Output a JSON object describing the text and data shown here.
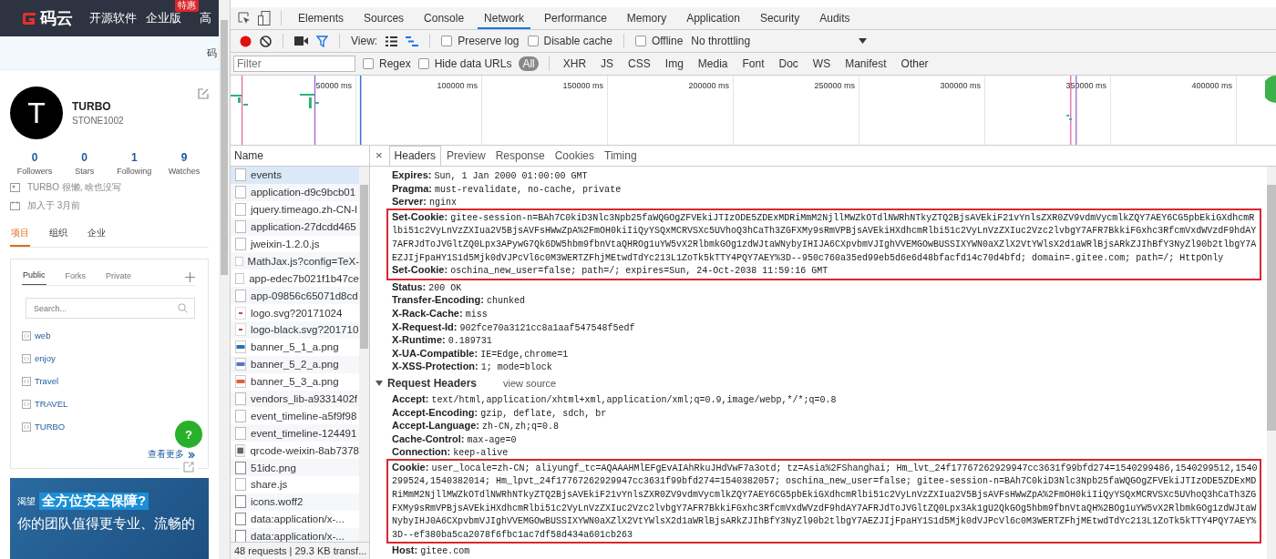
{
  "site": {
    "logo": "码云",
    "nav": [
      {
        "label": "开源软件"
      },
      {
        "label": "企业版",
        "badge": "特惠"
      },
      {
        "label": "高"
      }
    ],
    "subbar": "码",
    "profile": {
      "avatar_letter": "T",
      "name": "TURBO",
      "username": "STONE1002",
      "stats": [
        {
          "count": "0",
          "label": "Followers"
        },
        {
          "count": "0",
          "label": "Stars"
        },
        {
          "count": "1",
          "label": "Following"
        },
        {
          "count": "9",
          "label": "Watches"
        }
      ],
      "bio": "TURBO 很懒, 啥也没写",
      "joined": "加入于 3月前"
    },
    "tabs": [
      {
        "label": "项目",
        "selected": true
      },
      {
        "label": "组织",
        "selected": false
      },
      {
        "label": "企业",
        "selected": false
      }
    ],
    "repo_tabs": [
      {
        "label": "Public",
        "selected": true
      },
      {
        "label": "Forks",
        "selected": false
      },
      {
        "label": "Private",
        "selected": false
      }
    ],
    "search": {
      "placeholder": "Search..."
    },
    "repos": [
      "web",
      "enjoy",
      "Travel",
      "TRAVEL",
      "TURBO"
    ],
    "more": "查看更多",
    "help": "?",
    "banner": {
      "tag": "渴望",
      "headline": "全方位安全保障?",
      "text": "你的团队值得更专业、流畅的"
    }
  },
  "devtools": {
    "tabs": [
      {
        "label": "Elements",
        "selected": false
      },
      {
        "label": "Sources",
        "selected": false
      },
      {
        "label": "Console",
        "selected": false
      },
      {
        "label": "Network",
        "selected": true
      },
      {
        "label": "Performance",
        "selected": false
      },
      {
        "label": "Memory",
        "selected": false
      },
      {
        "label": "Application",
        "selected": false
      },
      {
        "label": "Security",
        "selected": false
      },
      {
        "label": "Audits",
        "selected": false
      }
    ],
    "recording": true,
    "filter_active": true,
    "view_label": "View:",
    "waterfall_view": true,
    "options": [
      {
        "label": "Preserve log",
        "checked": false
      },
      {
        "label": "Disable cache",
        "checked": false
      },
      {
        "label": "Offline",
        "checked": false
      }
    ],
    "throttling": "No throttling",
    "filter": {
      "placeholder": "Filter"
    },
    "filter_options": [
      {
        "label": "Regex",
        "checked": false
      },
      {
        "label": "Hide data URLs",
        "checked": false
      }
    ],
    "types": [
      {
        "label": "All",
        "selected": true
      },
      {
        "label": "XHR",
        "selected": false
      },
      {
        "label": "JS",
        "selected": false
      },
      {
        "label": "CSS",
        "selected": false
      },
      {
        "label": "Img",
        "selected": false
      },
      {
        "label": "Media",
        "selected": false
      },
      {
        "label": "Font",
        "selected": false
      },
      {
        "label": "Doc",
        "selected": false
      },
      {
        "label": "WS",
        "selected": false
      },
      {
        "label": "Manifest",
        "selected": false
      },
      {
        "label": "Other",
        "selected": false
      }
    ],
    "timeline_ticks": [
      "50000 ms",
      "100000 ms",
      "150000 ms",
      "200000 ms",
      "250000 ms",
      "300000 ms",
      "350000 ms",
      "400000 ms"
    ],
    "name_header": "Name",
    "requests": [
      {
        "name": "events",
        "kind": "file",
        "selected": true
      },
      {
        "name": "application-d9c9bcb01",
        "kind": "file",
        "selected": false
      },
      {
        "name": "jquery.timeago.zh-CN-l",
        "kind": "file",
        "selected": false
      },
      {
        "name": "application-27dcdd465",
        "kind": "file",
        "selected": false
      },
      {
        "name": "jweixin-1.2.0.js",
        "kind": "file",
        "selected": false
      },
      {
        "name": "MathJax.js?config=TeX-",
        "kind": "file",
        "selected": false
      },
      {
        "name": "app-edec7b021f1b47ce",
        "kind": "file",
        "selected": false
      },
      {
        "name": "app-09856c65071d8cd",
        "kind": "file",
        "selected": false
      },
      {
        "name": "logo.svg?20171024",
        "kind": "svg",
        "selected": false
      },
      {
        "name": "logo-black.svg?201710",
        "kind": "svg",
        "selected": false
      },
      {
        "name": "banner_5_1_a.png",
        "kind": "image",
        "color": "#2f6fb0",
        "selected": false
      },
      {
        "name": "banner_5_2_a.png",
        "kind": "image",
        "color": "#5a6fd0",
        "selected": false
      },
      {
        "name": "banner_5_3_a.png",
        "kind": "image",
        "color": "#e0603a",
        "selected": false
      },
      {
        "name": "vendors_lib-a9331402f",
        "kind": "file",
        "selected": false
      },
      {
        "name": "event_timeline-a5f9f98",
        "kind": "file",
        "selected": false
      },
      {
        "name": "event_timeline-124491",
        "kind": "file",
        "selected": false
      },
      {
        "name": "qrcode-weixin-8ab7378",
        "kind": "qrcode",
        "selected": false
      },
      {
        "name": "51idc.png",
        "kind": "blank",
        "selected": false
      },
      {
        "name": "share.js",
        "kind": "file",
        "selected": false
      },
      {
        "name": "icons.woff2",
        "kind": "blank",
        "selected": false
      },
      {
        "name": "data:application/x-...",
        "kind": "blank",
        "selected": false
      },
      {
        "name": "data:application/x-...",
        "kind": "blank",
        "selected": false
      }
    ],
    "summary": "48 requests | 29.3 KB transf...",
    "close_glyph": "×",
    "detail_tabs": [
      {
        "label": "Headers",
        "selected": true
      },
      {
        "label": "Preview",
        "selected": false
      },
      {
        "label": "Response",
        "selected": false
      },
      {
        "label": "Cookies",
        "selected": false
      },
      {
        "label": "Timing",
        "selected": false
      }
    ],
    "response_headers": [
      {
        "kind": "header",
        "name": "Expires:",
        "value": "Sun, 1 Jan 2000 01:00:00 GMT"
      },
      {
        "kind": "header",
        "name": "Pragma:",
        "value": "must-revalidate, no-cache, private"
      },
      {
        "kind": "header",
        "name": "Server:",
        "value": "nginx"
      },
      {
        "kind": "boxed",
        "headers": [
          {
            "name": "Set-Cookie:",
            "value": "gitee-session-n=BAh7C0kiD3Nlc3Npb25faWQGOgZFVEkiJTIzODE5ZDExMDRiMmM2NjllMWZkOTdlNWRhNTkyZTQ2BjsAVEkiF21vYnlsZXR0ZV9vdmVycmlkZQY7AEY6CG5pbEkiGXdhcmRlbi51c2VyLnVzZXIua2V5BjsAVFsHWwZpA%2FmOH0kiIiQyYSQxMCRVSXc5UVhoQ3hCaTh3ZGFXMy9sRmVPBjsAVEkiHXdhcmRlbi51c2VyLnVzZXIuc2Vzc2lvbgY7AFR7BkkiFGxhc3RfcmVxdWVzdF9hdAY7AFRJdToJVGltZQ0Lpx3APywG7Qk6DW5hbm9fbnVtaQHROg1uYW5vX2RlbmkGOg1zdWJtaWNybyIHIJA6CXpvbmVJIghVVEMGOwBUSSIXYWN0aXZlX2VtYWlsX2d1aWRlBjsARkZJIhBfY3NyZl90b2tlbgY7AEZJIjFpaHY1S1d5Mjk0dVJPcVl6c0M3WERTZFhjMEtwdTdYc213L1ZoTk5kTTY4PQY7AEY%3D--950c760a35ed99eb5d6e6d48bfacfd14c70d4bfd; domain=.gitee.com; path=/; HttpOnly"
          },
          {
            "name": "Set-Cookie:",
            "value": "oschina_new_user=false; path=/; expires=Sun, 24-Oct-2038 11:59:16 GMT"
          }
        ]
      },
      {
        "kind": "header",
        "name": "Status:",
        "value": "200 OK"
      },
      {
        "kind": "header",
        "name": "Transfer-Encoding:",
        "value": "chunked"
      },
      {
        "kind": "header",
        "name": "X-Rack-Cache:",
        "value": "miss"
      },
      {
        "kind": "header",
        "name": "X-Request-Id:",
        "value": "902fce70a3121cc8a1aaf547548f5edf"
      },
      {
        "kind": "header",
        "name": "X-Runtime:",
        "value": "0.189731"
      },
      {
        "kind": "header",
        "name": "X-UA-Compatible:",
        "value": "IE=Edge,chrome=1"
      },
      {
        "kind": "header",
        "name": "X-XSS-Protection:",
        "value": "1; mode=block"
      }
    ],
    "request_section": {
      "title": "Request Headers",
      "expanded": true,
      "link": "view source"
    },
    "request_headers": [
      {
        "kind": "header",
        "name": "Accept:",
        "value": "text/html,application/xhtml+xml,application/xml;q=0.9,image/webp,*/*;q=0.8"
      },
      {
        "kind": "header",
        "name": "Accept-Encoding:",
        "value": "gzip, deflate, sdch, br"
      },
      {
        "kind": "header",
        "name": "Accept-Language:",
        "value": "zh-CN,zh;q=0.8"
      },
      {
        "kind": "header",
        "name": "Cache-Control:",
        "value": "max-age=0"
      },
      {
        "kind": "header",
        "name": "Connection:",
        "value": "keep-alive"
      },
      {
        "kind": "boxed",
        "headers": [
          {
            "name": "Cookie:",
            "value": "user_locale=zh-CN; aliyungf_tc=AQAAAHMlEFgEvAIAhRkuJHdVwF7a3otd; tz=Asia%2FShanghai; Hm_lvt_24f17767262929947cc3631f99bfd274=1540299486,1540299512,1540299524,1540382014; Hm_lpvt_24f17767262929947cc3631f99bfd274=1540382057; oschina_new_user=false; gitee-session-n=BAh7C0kiD3Nlc3Npb25faWQGOgZFVEkiJTIzODE5ZDExMDRiMmM2NjllMWZkOTdlNWRhNTkyZTQ2BjsAVEkiF21vYnlsZXR0ZV9vdmVycmlkZQY7AEY6CG5pbEkiGXdhcmRlbi51c2VyLnVzZXIua2V5BjsAVFsHWwZpA%2FmOH0kiIiQyYSQxMCRVSXc5UVhoQ3hCaTh3ZGFXMy9sRmVPBjsAVEkiHXdhcmRlbi51c2VyLnVzZXIuc2Vzc2lvbgY7AFR7BkkiFGxhc3RfcmVxdWVzdF9hdAY7AFRJdToJVGltZQ0Lpx3Ak1gU2QkGOg5hbm9fbnVtaQH%2BOg1uYW5vX2RlbmkGOg1zdWJtaWNybyIHJ0A6CXpvbmVJIghVVEMGOwBUSSIXYWN0aXZlX2VtYWlsX2d1aWRlBjsARkZJIhBfY3NyZl90b2tlbgY7AEZJIjFpaHY1S1d5Mjk0dVJPcVl6c0M3WERTZFhjMEtwdTdYc213L1ZoTk5kTTY4PQY7AEY%3D--ef380ba5ca2078f6fbc1ac7df58d434a601cb263"
          }
        ]
      },
      {
        "kind": "header",
        "name": "Host:",
        "value": "gitee.com"
      }
    ]
  }
}
